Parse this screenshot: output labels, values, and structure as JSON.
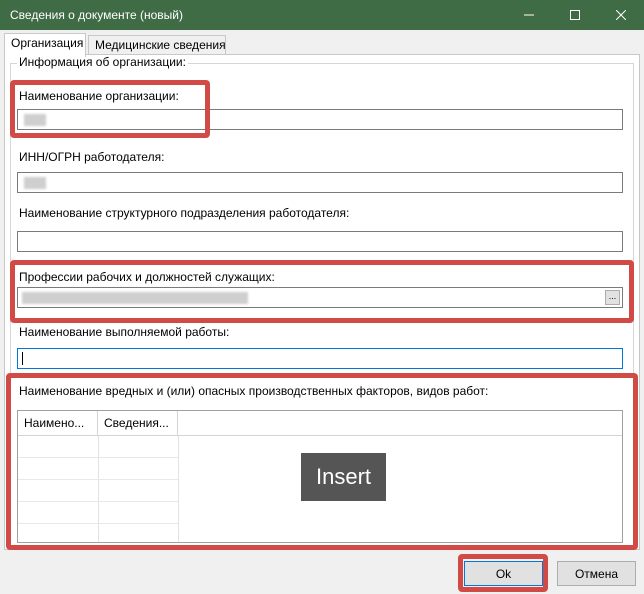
{
  "window": {
    "title": "Сведения о документе (новый)"
  },
  "tabs": [
    {
      "label": "Организация",
      "active": true
    },
    {
      "label": "Медицинские сведения",
      "active": false
    }
  ],
  "form": {
    "group_legend": "Информация об организации:",
    "org_name_label": "Наименование организации:",
    "inn_label": "ИНН/ОГРН работодателя:",
    "subdivision_label": "Наименование структурного подразделения работодателя:",
    "profession_label": "Профессии рабочих и должностей служащих:",
    "work_label": "Наименование выполняемой работы:",
    "factors_label": "Наименование вредных и (или) опасных производственных факторов, видов работ:",
    "ellipsis_button": "..."
  },
  "grid": {
    "columns": [
      "Наимено...",
      "Сведения..."
    ]
  },
  "overlay": {
    "text": "Insert"
  },
  "buttons": {
    "ok": "Ok",
    "cancel": "Отмена"
  },
  "colors": {
    "titlebar": "#3f6b45",
    "highlight": "#d14a45",
    "focus": "#0078d7"
  }
}
